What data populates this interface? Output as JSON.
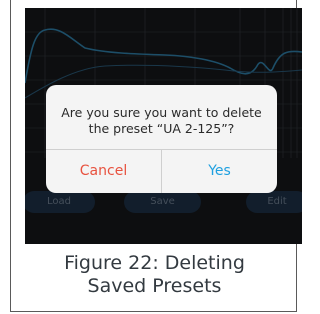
{
  "dialog": {
    "message": "Are you sure you want to delete the preset “UA 2-125”?",
    "cancel_label": "Cancel",
    "confirm_label": "Yes"
  },
  "background_buttons": {
    "load": "Load",
    "save": "Save",
    "edit": "Edit"
  },
  "caption": {
    "line1": "Figure 22: Deleting",
    "line2": "Saved Presets"
  },
  "colors": {
    "cancel": "#e8523f",
    "confirm": "#1fa0e0",
    "curve": "#2f7fa8",
    "background": "#15171a"
  }
}
